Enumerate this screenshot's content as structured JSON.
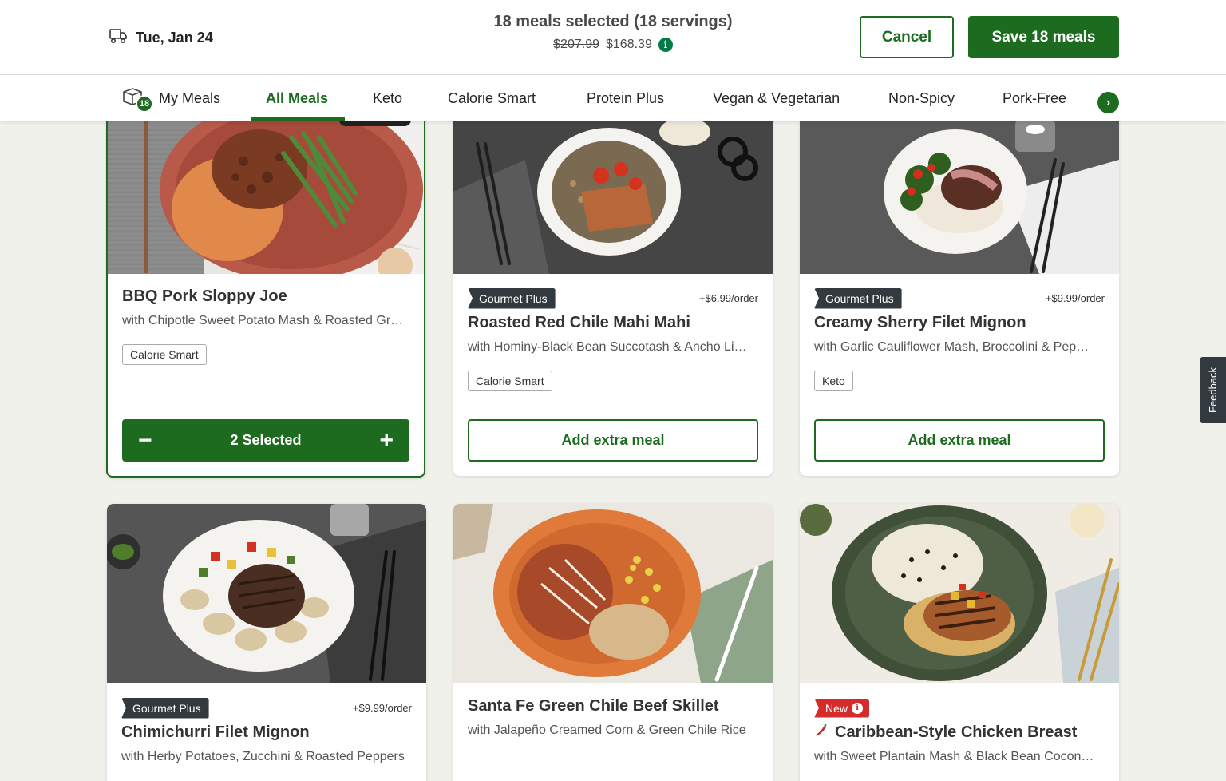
{
  "header": {
    "delivery_date": "Tue, Jan 24",
    "summary_title": "18 meals selected (18 servings)",
    "old_price": "$207.99",
    "new_price": "$168.39",
    "cancel_label": "Cancel",
    "save_label": "Save 18 meals"
  },
  "tabs": {
    "my_meals_count": "18",
    "items": [
      "My Meals",
      "All Meals",
      "Keto",
      "Calorie Smart",
      "Protein Plus",
      "Vegan & Vegetarian",
      "Non-Spicy",
      "Pork-Free"
    ],
    "active": "All Meals"
  },
  "meals": [
    {
      "title": "BBQ Pork Sloppy Joe",
      "subtitle": "with Chipotle Sweet Potato Mash & Roasted Gr…",
      "tag": "Calorie Smart",
      "selected_label": "2 Selected",
      "selected_count": 2
    },
    {
      "badge": "Gourmet Plus",
      "price": "+$6.99/order",
      "title": "Roasted Red Chile Mahi Mahi",
      "subtitle": "with Hominy-Black Bean Succotash & Ancho Li…",
      "tag": "Calorie Smart",
      "button": "Add extra meal"
    },
    {
      "badge": "Gourmet Plus",
      "price": "+$9.99/order",
      "title": "Creamy Sherry Filet Mignon",
      "subtitle": "with Garlic Cauliflower Mash, Broccolini & Pep…",
      "tag": "Keto",
      "button": "Add extra meal"
    },
    {
      "badge": "Gourmet Plus",
      "price": "+$9.99/order",
      "title": "Chimichurri Filet Mignon",
      "subtitle": "with Herby Potatoes, Zucchini & Roasted Peppers"
    },
    {
      "title": "Santa Fe Green Chile Beef Skillet",
      "subtitle": "with Jalapeño Creamed Corn & Green Chile Rice"
    },
    {
      "badge": "New",
      "title": "Caribbean-Style Chicken Breast",
      "subtitle": "with Sweet Plantain Mash & Black Bean Cocon…"
    }
  ],
  "feedback_label": "Feedback",
  "colors": {
    "brand_green": "#1d6b1f",
    "gourmet_badge": "#333a3f",
    "new_badge": "#d62b2b"
  }
}
